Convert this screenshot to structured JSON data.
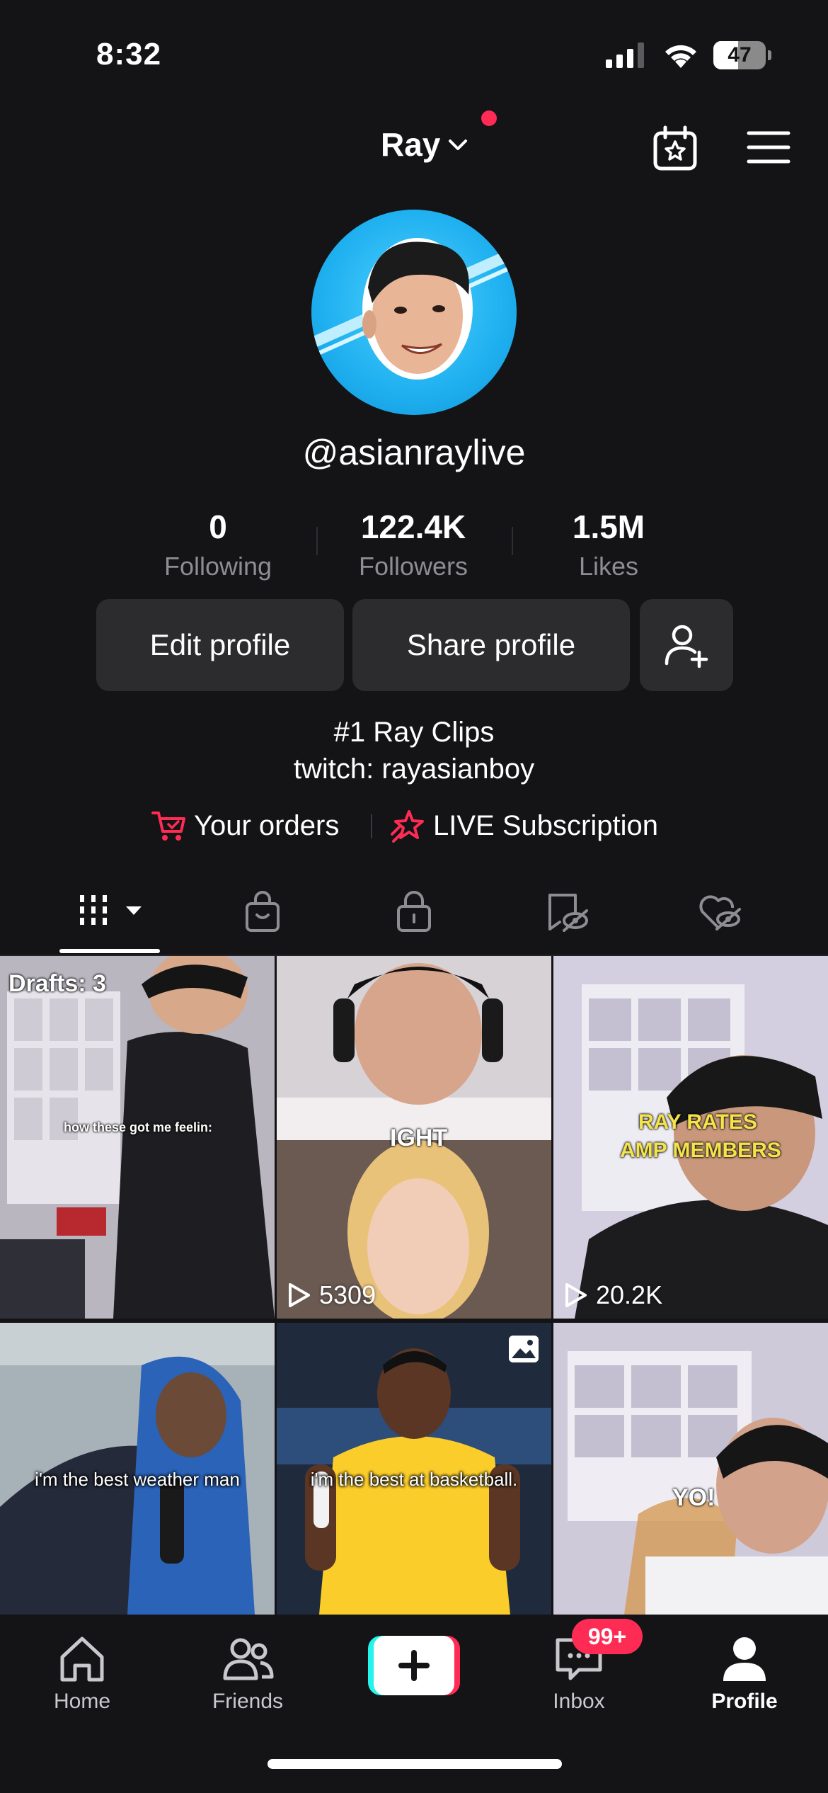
{
  "status_bar": {
    "time": "8:32",
    "battery": "47",
    "battery_level": 0.47
  },
  "header": {
    "account_name": "Ray"
  },
  "profile": {
    "username": "@asianraylive",
    "stats": [
      {
        "value": "0",
        "label": "Following"
      },
      {
        "value": "122.4K",
        "label": "Followers"
      },
      {
        "value": "1.5M",
        "label": "Likes"
      }
    ],
    "edit_label": "Edit profile",
    "share_label": "Share profile",
    "bio_line1": "#1 Ray Clips",
    "bio_line2": "twitch: rayasianboy",
    "orders_label": "Your orders",
    "live_sub_label": "LIVE Subscription"
  },
  "tabs": [
    "videos-grid-icon",
    "shop-bag-icon",
    "private-lock-icon",
    "reposts-icon",
    "liked-icon"
  ],
  "grid": {
    "drafts_label": "Drafts: 3",
    "tiles": [
      {
        "overlay": "how these got me feelin:"
      },
      {
        "overlay": "IGHT",
        "views": "5309"
      },
      {
        "overlay_line1": "RAY RATES",
        "overlay_line2": "AMP MEMBERS",
        "views": "20.2K"
      },
      {
        "caption": "i'm the best weather man"
      },
      {
        "caption": "i'm the best at basketball."
      },
      {
        "overlay": "YO!"
      }
    ]
  },
  "nav": {
    "home": "Home",
    "friends": "Friends",
    "inbox": "Inbox",
    "inbox_badge": "99+",
    "profile": "Profile"
  },
  "colors": {
    "accent": "#fe2c55",
    "cyan": "#25f4ee",
    "background": "#141316",
    "button": "#2c2c2f"
  }
}
